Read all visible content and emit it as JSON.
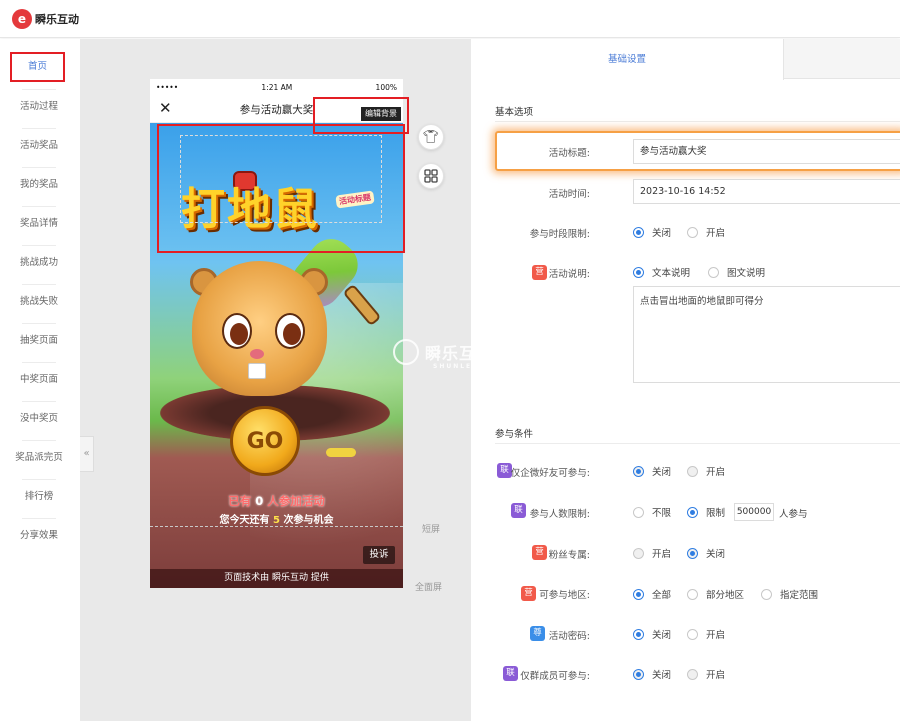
{
  "brand": {
    "name": "瞬乐互动"
  },
  "sidebar": {
    "items": [
      {
        "label": "首页",
        "active": true
      },
      {
        "label": "活动过程"
      },
      {
        "label": "活动奖品"
      },
      {
        "label": "我的奖品"
      },
      {
        "label": "奖品详情"
      },
      {
        "label": "挑战成功"
      },
      {
        "label": "挑战失败"
      },
      {
        "label": "抽奖页面"
      },
      {
        "label": "中奖页面"
      },
      {
        "label": "没中奖页"
      },
      {
        "label": "奖品派完页"
      },
      {
        "label": "排行榜"
      },
      {
        "label": "分享效果"
      }
    ],
    "collapse_glyph": "«"
  },
  "phone": {
    "status": {
      "signal": "•••••",
      "time": "1:21 AM",
      "battery": "100%"
    },
    "title": "参与活动赢大奖",
    "close_glyph": "✕",
    "game": {
      "logo_text": "打地鼠",
      "logo_sub": "活动标题",
      "go_label": "GO",
      "joined_prefix": "已有",
      "joined_count": "0",
      "joined_suffix": "人参加活动",
      "chance_prefix": "您今天还有",
      "chance_count": "5",
      "chance_suffix": "次参与机会",
      "report_label": "投诉",
      "footer": "页面技术由 瞬乐互动 提供"
    }
  },
  "canvas": {
    "edit_bg_tip": "编辑背景",
    "short_screen": "短屏",
    "full_screen": "全面屏",
    "watermark": "瞬乐互动",
    "watermark_sub": "SHUNLEHUDONG"
  },
  "panel": {
    "tab_label": "基础设置",
    "basic_title": "基本选项",
    "fields": {
      "title_label": "活动标题:",
      "title_value": "参与活动赢大奖",
      "time_label": "活动时间:",
      "time_value": "2023-10-16 14:52",
      "period_label": "参与时段限制:",
      "period_off": "关闭",
      "period_on": "开启",
      "desc_label": "活动说明:",
      "desc_text_opt": "文本说明",
      "desc_img_opt": "图文说明",
      "desc_value": "点击冒出地面的地鼠即可得分"
    },
    "conditions_title": "参与条件",
    "conditions": {
      "wecom_label": "仅企微好友可参与:",
      "wecom_off": "关闭",
      "wecom_on": "开启",
      "count_label": "参与人数限制:",
      "count_unlimited": "不限",
      "count_limit": "限制",
      "count_value": "500000",
      "count_unit": "人参与",
      "fans_label": "粉丝专属:",
      "fans_on": "开启",
      "fans_off": "关闭",
      "region_label": "可参与地区:",
      "region_all": "全部",
      "region_part": "部分地区",
      "region_range": "指定范围",
      "pwd_label": "活动密码:",
      "pwd_off": "关闭",
      "pwd_on": "开启",
      "group_label": "仅群成员可参与:",
      "group_off": "关闭",
      "group_on": "开启"
    },
    "badges": {
      "ying": "营",
      "lian": "联",
      "zun": "尊"
    }
  }
}
